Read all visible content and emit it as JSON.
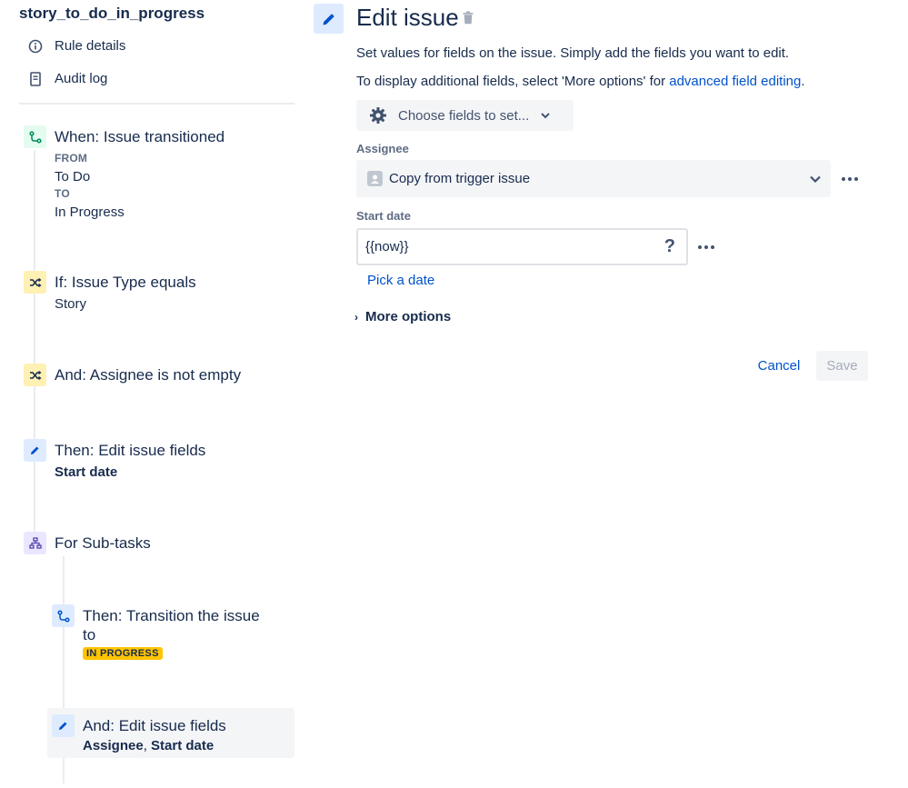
{
  "rule": {
    "title": "story_to_do_in_progress",
    "nav": [
      {
        "label": "Rule details",
        "icon": "info-icon"
      },
      {
        "label": "Audit log",
        "icon": "document-icon"
      }
    ]
  },
  "components": {
    "trigger": {
      "title": "When: Issue transitioned",
      "from_label": "FROM",
      "from_value": "To Do",
      "to_label": "TO",
      "to_value": "In Progress",
      "icon": "transition-icon"
    },
    "condition1": {
      "title": "If: Issue Type equals",
      "sub": "Story",
      "icon": "shuffle-icon"
    },
    "condition2": {
      "title": "And: Assignee is not empty",
      "icon": "shuffle-icon"
    },
    "action1": {
      "title": "Then: Edit issue fields",
      "sub": "Start date",
      "icon": "pencil-icon"
    },
    "branch": {
      "title": "For Sub-tasks",
      "icon": "hierarchy-icon"
    },
    "action2": {
      "title_line1": "Then: Transition the issue",
      "title_line2": "to",
      "status": "IN PROGRESS",
      "icon": "transition-icon"
    },
    "action3": {
      "title": "And: Edit issue fields",
      "sub_bold1": "Assignee",
      "sub_sep": ", ",
      "sub_bold2": "Start date",
      "icon": "pencil-icon"
    }
  },
  "editor": {
    "title": "Edit issue",
    "description": "Set values for fields on the issue. Simply add the fields you want to edit.",
    "additional_prefix": "To display additional fields, select 'More options' for ",
    "additional_link": "advanced field editing",
    "additional_suffix": ".",
    "choose_fields_label": "Choose fields to set...",
    "assignee": {
      "label": "Assignee",
      "value": "Copy from trigger issue"
    },
    "start_date": {
      "label": "Start date",
      "value": "{{now}}",
      "help": "?"
    },
    "pick_date_label": "Pick a date",
    "more_options_label": "More options",
    "cancel_label": "Cancel",
    "save_label": "Save"
  },
  "colors": {
    "link": "#0052cc",
    "text": "#172b4d",
    "lozenge_in_progress": "#ffc400"
  }
}
